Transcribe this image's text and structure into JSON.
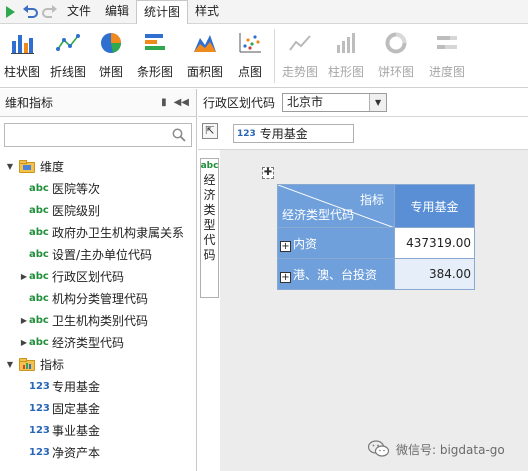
{
  "menubar": {
    "menus": [
      {
        "label": "文件",
        "active": false
      },
      {
        "label": "编辑",
        "active": false
      },
      {
        "label": "统计图",
        "active": true
      },
      {
        "label": "样式",
        "active": false
      }
    ]
  },
  "ribbon": {
    "enabled": [
      {
        "label": "柱状图",
        "icon": "bar-chart-icon"
      },
      {
        "label": "折线图",
        "icon": "line-chart-icon"
      },
      {
        "label": "饼图",
        "icon": "pie-chart-icon"
      },
      {
        "label": "条形图",
        "icon": "horizontal-bar-icon"
      },
      {
        "label": "面积图",
        "icon": "area-chart-icon"
      },
      {
        "label": "点图",
        "icon": "scatter-chart-icon"
      }
    ],
    "disabled": [
      {
        "label": "走势图",
        "icon": "trend-chart-icon"
      },
      {
        "label": "柱形图",
        "icon": "column-chart-icon"
      },
      {
        "label": "饼环图",
        "icon": "donut-chart-icon"
      },
      {
        "label": "进度图",
        "icon": "progress-chart-icon"
      }
    ]
  },
  "left_panel": {
    "title": "维和指标",
    "search_placeholder": "",
    "dimension_group": "维度",
    "dimensions": [
      {
        "label": "医院等次",
        "expandable": false
      },
      {
        "label": "医院级别",
        "expandable": false
      },
      {
        "label": "政府办卫生机构隶属关系",
        "expandable": false
      },
      {
        "label": "设置/主办单位代码",
        "expandable": false
      },
      {
        "label": "行政区划代码",
        "expandable": true
      },
      {
        "label": "机构分类管理代码",
        "expandable": false
      },
      {
        "label": "卫生机构类别代码",
        "expandable": true
      },
      {
        "label": "经济类型代码",
        "expandable": true
      }
    ],
    "measure_group": "指标",
    "measures": [
      {
        "label": "专用基金"
      },
      {
        "label": "固定基金"
      },
      {
        "label": "事业基金"
      },
      {
        "label": "净资产本"
      }
    ],
    "tags": {
      "abc": "abc",
      "num": "123"
    }
  },
  "filter": {
    "label": "行政区划代码",
    "value": "北京市"
  },
  "column_field": {
    "tag": "123",
    "label": "专用基金"
  },
  "row_field": {
    "tag": "abc",
    "label": "经济类型代码"
  },
  "pivot": {
    "corner_top": "指标",
    "corner_bottom": "经济类型代码",
    "column_header": "专用基金",
    "rows": [
      {
        "label": "内资",
        "value": "437319.00"
      },
      {
        "label": "港、澳、台投资",
        "value": "384.00"
      }
    ]
  },
  "watermark": {
    "text": "微信号: bigdata-go"
  },
  "colors": {
    "accent_blue": "#5a8fd6",
    "header_blue": "#6fa0dc",
    "abc_green": "#1f8f3a",
    "num_blue": "#2866b8"
  }
}
